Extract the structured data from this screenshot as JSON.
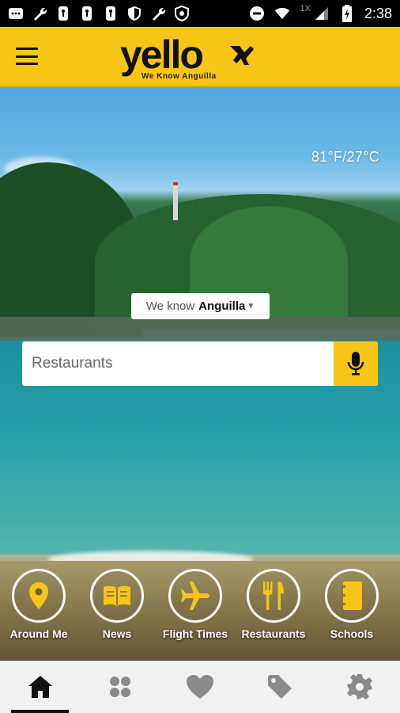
{
  "status_bar": {
    "time": "2:38",
    "signal_label": "1X"
  },
  "header": {
    "brand": "yello",
    "tagline": "We Know Anguilla",
    "accent_color": "#f7c516"
  },
  "hero": {
    "weather": "81°F/27°C",
    "location_prefix": "We know",
    "location_value": "Anguilla"
  },
  "search": {
    "placeholder": "Restaurants"
  },
  "quick_links": [
    {
      "label": "Around Me",
      "icon": "location-pin-icon"
    },
    {
      "label": "News",
      "icon": "newspaper-icon"
    },
    {
      "label": "Flight Times",
      "icon": "airplane-icon"
    },
    {
      "label": "Restaurants",
      "icon": "fork-knife-icon"
    },
    {
      "label": "Schools",
      "icon": "notebook-icon"
    }
  ],
  "bottom_nav": [
    {
      "icon": "home-icon",
      "active": true
    },
    {
      "icon": "categories-icon",
      "active": false
    },
    {
      "icon": "heart-icon",
      "active": false
    },
    {
      "icon": "tag-icon",
      "active": false
    },
    {
      "icon": "gear-icon",
      "active": false
    }
  ]
}
